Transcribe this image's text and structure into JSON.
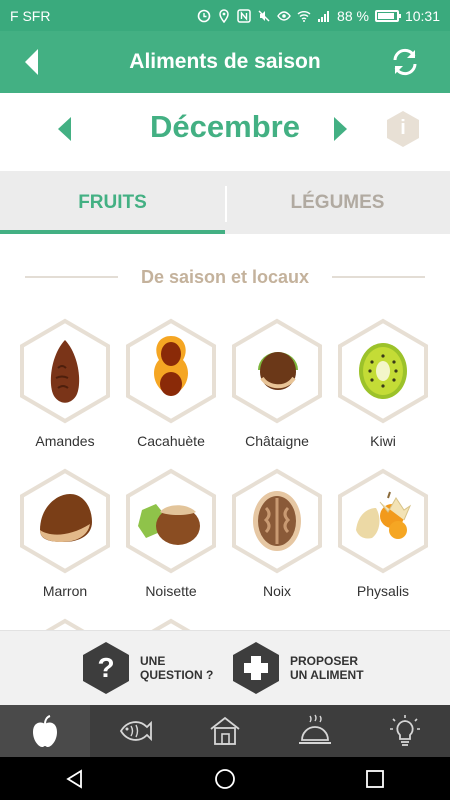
{
  "status_bar": {
    "carrier": "F SFR",
    "battery": "88 %",
    "battery_level": 0.88,
    "time": "10:31"
  },
  "app_bar": {
    "title": "Aliments de saison"
  },
  "month_selector": {
    "month": "Décembre",
    "info_label": "i"
  },
  "tabs": [
    {
      "label": "FRUITS",
      "active": true
    },
    {
      "label": "LÉGUMES",
      "active": false
    }
  ],
  "section": {
    "title": "De saison et locaux"
  },
  "items": [
    {
      "label": "Amandes",
      "icon": "almond-icon"
    },
    {
      "label": "Cacahuète",
      "icon": "peanut-icon"
    },
    {
      "label": "Châtaigne",
      "icon": "chestnut-icon"
    },
    {
      "label": "Kiwi",
      "icon": "kiwi-icon"
    },
    {
      "label": "Marron",
      "icon": "marron-icon"
    },
    {
      "label": "Noisette",
      "icon": "hazelnut-icon"
    },
    {
      "label": "Noix",
      "icon": "walnut-icon"
    },
    {
      "label": "Physalis",
      "icon": "physalis-icon"
    }
  ],
  "actions": {
    "question_icon": "?",
    "question_label_line1": "UNE",
    "question_label_line2": "QUESTION ?",
    "propose_label_line1": "PROPOSER",
    "propose_label_line2": "UN ALIMENT"
  },
  "bottom_tabs": [
    {
      "icon": "apple-icon",
      "active": true
    },
    {
      "icon": "fish-icon",
      "active": false
    },
    {
      "icon": "house-icon",
      "active": false
    },
    {
      "icon": "cloche-icon",
      "active": false
    },
    {
      "icon": "lightbulb-icon",
      "active": false
    }
  ],
  "colors": {
    "brand_green": "#43b083",
    "hex_border": "#e7dfd4",
    "tab_bar": "#3d3d3d"
  }
}
